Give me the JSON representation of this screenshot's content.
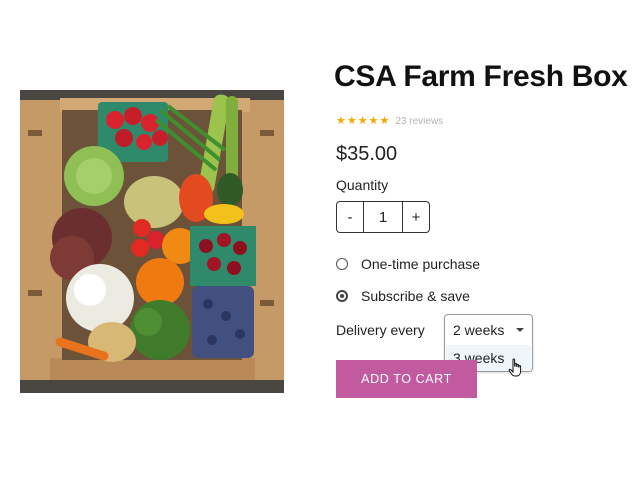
{
  "product": {
    "title": "CSA Farm Fresh Box",
    "rating_stars": 5,
    "reviews_text": "23 reviews",
    "price": "$35.00",
    "image_subject": "cardboard box of fresh vegetables and fruit"
  },
  "quantity": {
    "label": "Quantity",
    "decrement_label": "-",
    "value": "1",
    "increment_label": "+"
  },
  "purchase_options": [
    {
      "label": "One-time purchase",
      "selected": false
    },
    {
      "label": "Subscribe & save",
      "selected": true
    }
  ],
  "delivery": {
    "label": "Delivery every",
    "selected_value": "2 weeks",
    "open_option": "3 weeks"
  },
  "cart_button": {
    "label": "ADD TO CART"
  },
  "colors": {
    "star": "#f2a900",
    "cart_button": "#c15a9f",
    "dropdown_highlight": "#eef6fb"
  },
  "icons": [
    "star-icon",
    "radio-icon",
    "chevron-down-icon",
    "hand-pointer-cursor-icon"
  ]
}
